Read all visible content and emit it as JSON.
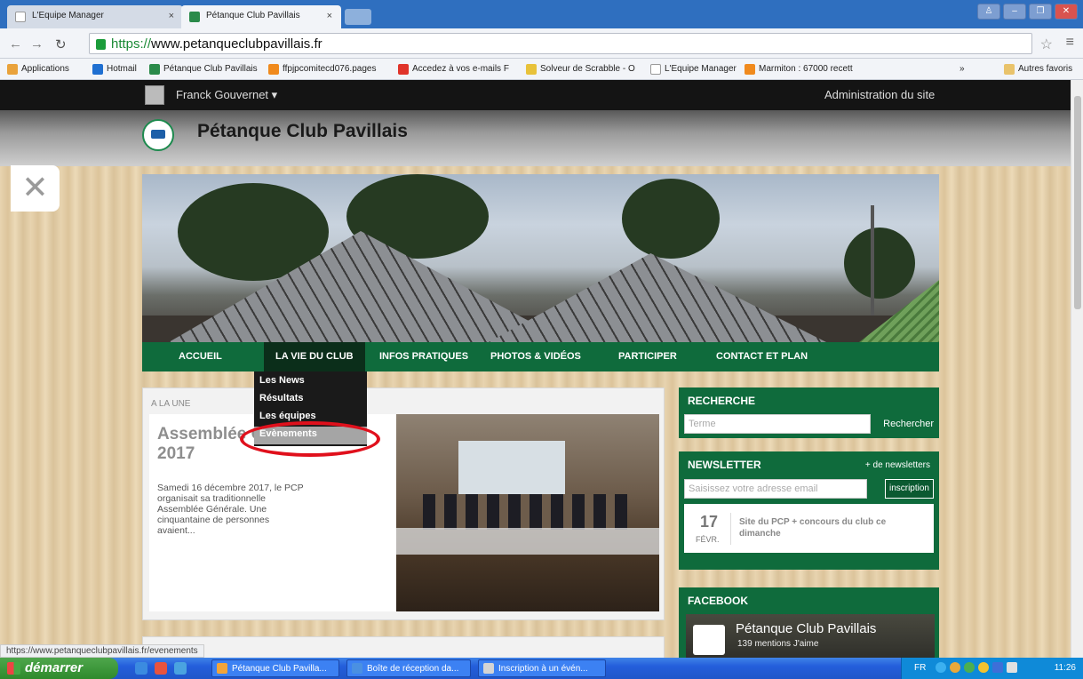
{
  "browser": {
    "tabs": [
      {
        "label": "L'Equipe Manager",
        "close": "×"
      },
      {
        "label": "Pétanque Club Pavillais",
        "close": "×"
      }
    ],
    "url_scheme": "https://",
    "url_rest": "www.petanqueclubpavillais.fr",
    "bookmarks": [
      {
        "label": "Applications",
        "color": "#e9a23b"
      },
      {
        "label": "Hotmail",
        "color": "#1f6fd1"
      },
      {
        "label": "Pétanque Club Pavillais",
        "color": "#2a8a4a"
      },
      {
        "label": "ffpjpcomitecd076.pages",
        "color": "#f08a1d"
      },
      {
        "label": "Accedez à vos e-mails F",
        "color": "#e0342a"
      },
      {
        "label": "Solveur de Scrabble - O",
        "color": "#e8c23a"
      },
      {
        "label": "L'Equipe Manager",
        "color": "#888888"
      },
      {
        "label": "Marmiton : 67000 recett",
        "color": "#f08a1d"
      }
    ],
    "more_bookmarks": "»",
    "other_bookmarks": "Autres favoris",
    "status_url": "https://www.petanqueclubpavillais.fr/evenements"
  },
  "admin_bar": {
    "user": "Franck Gouvernet ▾",
    "admin_link": "Administration du site"
  },
  "site": {
    "title": "Pétanque Club Pavillais",
    "nav": [
      "ACCUEIL",
      "LA VIE DU CLUB",
      "INFOS PRATIQUES",
      "PHOTOS & VIDÉOS",
      "PARTICIPER",
      "CONTACT ET PLAN"
    ],
    "dropdown": [
      "Les News",
      "Résultats",
      "Les équipes",
      "Évènements"
    ]
  },
  "article": {
    "kicker": "A LA UNE",
    "headline": "Assemblée Générale 2017",
    "excerpt": "Samedi 16 décembre 2017, le PCP organisait sa traditionnelle Assemblée Générale. Une cinquantaine de personnes avaient..."
  },
  "search_widget": {
    "title": "RECHERCHE",
    "placeholder": "Terme",
    "button": "Rechercher"
  },
  "newsletter_widget": {
    "title": "NEWSLETTER",
    "more": "+ de newsletters",
    "placeholder": "Saisissez votre adresse email",
    "button": "inscription",
    "item": {
      "day": "17",
      "month": "FÉVR.",
      "text": "Site du PCP + concours du club ce dimanche"
    }
  },
  "facebook_widget": {
    "title": "FACEBOOK",
    "page_name": "Pétanque Club Pavillais",
    "likes": "139 mentions J'aime"
  },
  "taskbar": {
    "start": "démarrer",
    "tasks": [
      "Pétanque Club Pavilla...",
      "Boîte de réception da...",
      "Inscription à un évén..."
    ],
    "lang": "FR",
    "clock": "11:26"
  },
  "colors": {
    "brand_green": "#0f6b3c",
    "highlight_ring": "#e0101c"
  }
}
